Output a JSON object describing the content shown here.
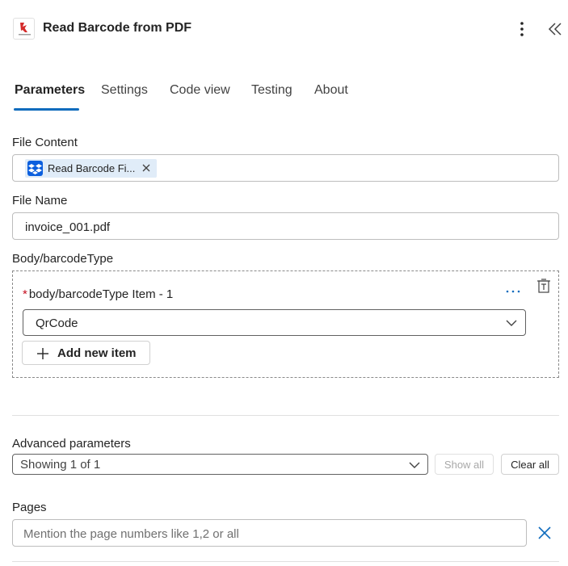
{
  "header": {
    "title": "Read Barcode from PDF",
    "logo_icon": "pdf4me-logo-icon",
    "more_icon": "more-vertical-icon",
    "collapse_icon": "double-chevron-left-icon"
  },
  "tabs": [
    {
      "label": "Parameters",
      "active": true
    },
    {
      "label": "Settings",
      "active": false
    },
    {
      "label": "Code view",
      "active": false
    },
    {
      "label": "Testing",
      "active": false
    },
    {
      "label": "About",
      "active": false
    }
  ],
  "accent_color": "#0f6cbd",
  "file_content": {
    "label": "File Content",
    "token_label": "Read Barcode Fi...",
    "token_icon": "dropbox-icon"
  },
  "file_name": {
    "label": "File Name",
    "value": "invoice_001.pdf"
  },
  "barcode_type": {
    "label": "Body/barcodeType",
    "item_label": "body/barcodeType Item - 1",
    "required_marker": "*",
    "selected": "QrCode",
    "add_label": "Add new item"
  },
  "advanced": {
    "label": "Advanced parameters",
    "selected": "Showing 1 of 1",
    "show_all": "Show all",
    "clear_all": "Clear all"
  },
  "pages": {
    "label": "Pages",
    "placeholder": "Mention the page numbers like 1,2 or all"
  }
}
